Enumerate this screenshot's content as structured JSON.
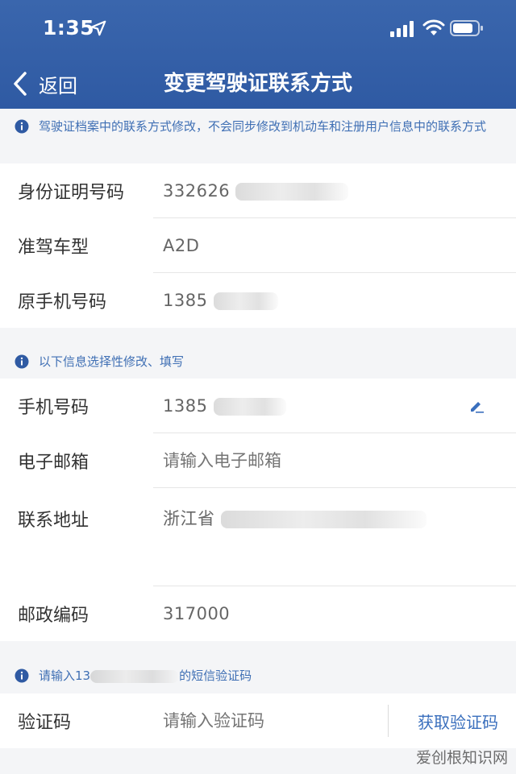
{
  "status_bar": {
    "time": "1:35"
  },
  "nav": {
    "back_label": "返回",
    "title": "变更驾驶证联系方式"
  },
  "notice_top": {
    "text": "驾驶证档案中的联系方式修改，不会同步修改到机动车和注册用户信息中的联系方式"
  },
  "readonly_section": {
    "rows": [
      {
        "label": "身份证明号码",
        "value": "332626"
      },
      {
        "label": "准驾车型",
        "value": "A2D"
      },
      {
        "label": "原手机号码",
        "value": "1385"
      }
    ]
  },
  "notice_optional": {
    "text": "以下信息选择性修改、填写"
  },
  "edit_section": {
    "phone": {
      "label": "手机号码",
      "value": "1385"
    },
    "email": {
      "label": "电子邮箱",
      "placeholder": "请输入电子邮箱"
    },
    "address": {
      "label": "联系地址",
      "value": "浙江省"
    },
    "postcode": {
      "label": "邮政编码",
      "value": "317000"
    }
  },
  "notice_sms": {
    "prefix": "请输入13",
    "suffix": "的短信验证码"
  },
  "verify": {
    "label": "验证码",
    "placeholder": "请输入验证码",
    "button": "获取验证码"
  },
  "watermark": "爱创根知识网",
  "colors": {
    "header": "#2f5aa3",
    "accent": "#3a6fbd",
    "background": "#f4f5f7"
  },
  "icons": [
    "location-arrow-icon",
    "signal-icon",
    "wifi-icon",
    "battery-icon",
    "back-chevron-icon",
    "info-icon",
    "edit-pencil-icon"
  ]
}
